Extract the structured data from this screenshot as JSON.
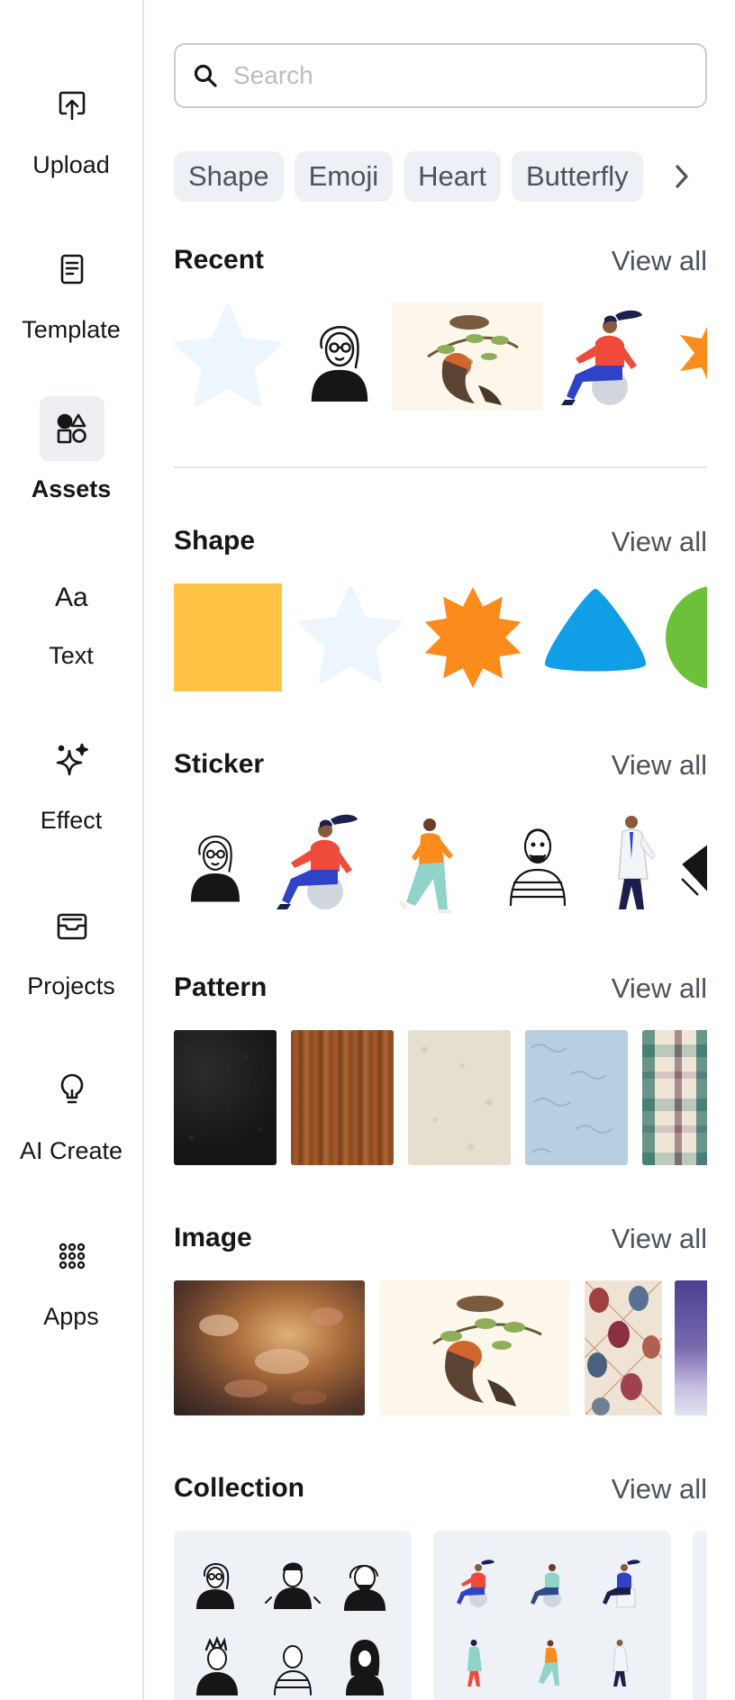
{
  "sidebar": {
    "items": [
      {
        "label": "Upload",
        "icon": "upload-icon"
      },
      {
        "label": "Template",
        "icon": "template-icon"
      },
      {
        "label": "Assets",
        "icon": "assets-icon",
        "active": true
      },
      {
        "label": "Text",
        "icon": "text-icon"
      },
      {
        "label": "Effect",
        "icon": "effect-icon"
      },
      {
        "label": "Projects",
        "icon": "projects-icon"
      },
      {
        "label": "AI Create",
        "icon": "ai-create-icon"
      },
      {
        "label": "Apps",
        "icon": "apps-icon"
      }
    ]
  },
  "search": {
    "placeholder": "Search",
    "value": ""
  },
  "chips": [
    "Shape",
    "Emoji",
    "Heart",
    "Butterfly"
  ],
  "sections": {
    "recent": {
      "title": "Recent",
      "view_all": "View all"
    },
    "shape": {
      "title": "Shape",
      "view_all": "View all"
    },
    "sticker": {
      "title": "Sticker",
      "view_all": "View all"
    },
    "pattern": {
      "title": "Pattern",
      "view_all": "View all"
    },
    "image": {
      "title": "Image",
      "view_all": "View all"
    },
    "collection": {
      "title": "Collection",
      "view_all": "View all"
    }
  },
  "colors": {
    "accent_yellow": "#ffc445",
    "accent_orange": "#fb8c1c",
    "accent_blue": "#109ee6",
    "accent_green": "#6cc03a",
    "pale_star": "#edf6fd",
    "active_nav_bg": "#eceef2"
  }
}
